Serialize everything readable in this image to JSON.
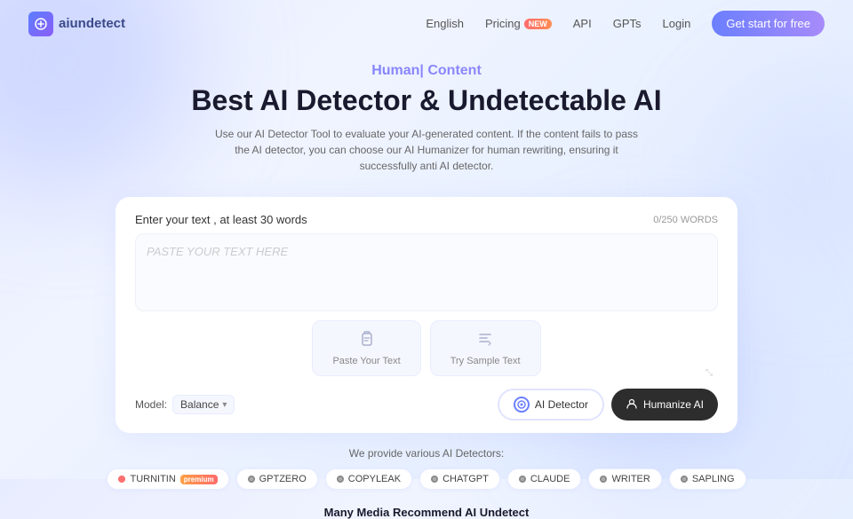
{
  "brand": {
    "name": "aiundetect",
    "logo_icon": "A"
  },
  "nav": {
    "links": [
      {
        "id": "english",
        "label": "English"
      },
      {
        "id": "pricing",
        "label": "Pricing"
      },
      {
        "id": "api",
        "label": "API"
      },
      {
        "id": "gpts",
        "label": "GPTs"
      },
      {
        "id": "login",
        "label": "Login"
      }
    ],
    "pricing_badge": "NEW",
    "cta_label": "Get start for free"
  },
  "hero": {
    "subtitle": "Human| Content",
    "title": "Best AI Detector & Undetectable AI",
    "description": "Use our AI Detector Tool to evaluate your AI-generated content. If the content fails to pass the AI detector, you can choose our AI Humanizer for human rewriting, ensuring it successfully anti AI detector."
  },
  "editor": {
    "label": "Enter your text , at least 30 words",
    "word_count": "0/250 WORDS",
    "placeholder": "PASTE YOUR TEXT HERE",
    "paste_btn": "Paste Your Text",
    "sample_btn": "Try Sample Text",
    "model_label": "Model:",
    "model_value": "Balance",
    "detector_btn": "AI Detector",
    "humanize_btn": "Humanize AI"
  },
  "detectors": {
    "title": "We provide various AI Detectors:",
    "items": [
      {
        "id": "turnitin",
        "label": "TURNITIN",
        "badge": "premium",
        "type": "turnitin"
      },
      {
        "id": "gptzero",
        "label": "GPTZERO",
        "type": "gptzero"
      },
      {
        "id": "copyleak",
        "label": "COPYLEAK",
        "type": "copyleak"
      },
      {
        "id": "chatgpt",
        "label": "CHATGPT",
        "type": "chatgpt"
      },
      {
        "id": "claude",
        "label": "CLAUDE",
        "type": "claude"
      },
      {
        "id": "writer",
        "label": "WRITER",
        "type": "writer"
      },
      {
        "id": "sapling",
        "label": "SAPLING",
        "type": "sapling"
      }
    ]
  },
  "footer_promo": "Many Media Recommend AI Undetect"
}
